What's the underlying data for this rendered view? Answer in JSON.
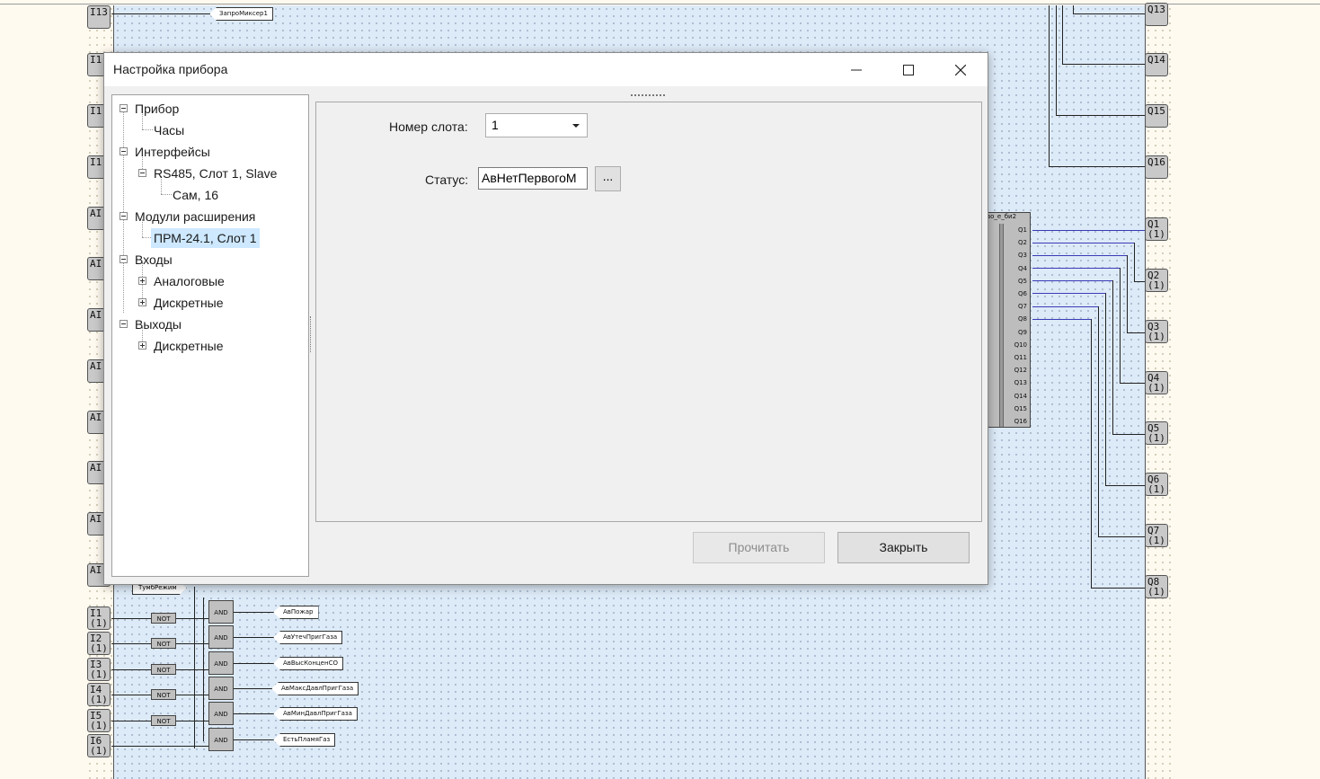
{
  "dialog": {
    "title": "Настройка прибора",
    "tree": {
      "device": "Прибор",
      "clock": "Часы",
      "interfaces": "Интерфейсы",
      "rs485": "RS485, Слот 1, Slave",
      "self": "Сам, 16",
      "modules": "Модули расширения",
      "prm": "ПРМ-24.1, Слот 1",
      "inputs": "Входы",
      "analog": "Аналоговые",
      "discrete_in": "Дискретные",
      "outputs": "Выходы",
      "discrete_out": "Дискретные"
    },
    "slot_label": "Номер слота:",
    "slot_value": "1",
    "status_label": "Статус:",
    "status_value": "АвНетПервогоМ",
    "browse_label": "...",
    "read_button": "Прочитать",
    "close_button": "Закрыть"
  },
  "diagram": {
    "left_pins": {
      "top": "I13",
      "hidden_a": "I1",
      "hidden_b": "I1",
      "hidden_c": "I1",
      "ai_1": "AI",
      "ai_2": "AI",
      "ai_3": "AI",
      "ai_4": "AI",
      "ai_5": "AI",
      "ai_6": "AI",
      "ai_7": "AI",
      "ai_8": "AI",
      "i1": "I1\n(1)",
      "i2": "I2\n(1)",
      "i3": "I3\n(1)",
      "i4": "I4\n(1)",
      "i5": "I5\n(1)",
      "i6": "I6\n(1)"
    },
    "right_pins": {
      "q13": "Q13",
      "q14": "Q14",
      "q15": "Q15",
      "q16": "Q16",
      "q1": "Q1\n(1)",
      "q2": "Q2\n(1)",
      "q3": "Q3\n(1)",
      "q4": "Q4\n(1)",
      "q5": "Q5\n(1)",
      "q6": "Q6\n(1)",
      "q7": "Q7\n(1)",
      "q8": "Q8\n(1)"
    },
    "top_tag": "ЗапроМиксер1",
    "tumbler_tag": "ТумбРежим",
    "block_title": "во_е_би2",
    "block_outputs": [
      "Q1",
      "Q2",
      "Q3",
      "Q4",
      "Q5",
      "Q6",
      "Q7",
      "Q8",
      "Q9",
      "Q10",
      "Q11",
      "Q12",
      "Q13",
      "Q14",
      "Q15",
      "Q16"
    ],
    "not_label": "NOT",
    "and_label": "AND",
    "output_tags": [
      "АвПожар",
      "АвУтечПригГаза",
      "АвВысКонценСО",
      "АвМаксДавлПригГаза",
      "АвМинДавлПригГаза",
      "ЕстьПламяГаз"
    ]
  }
}
